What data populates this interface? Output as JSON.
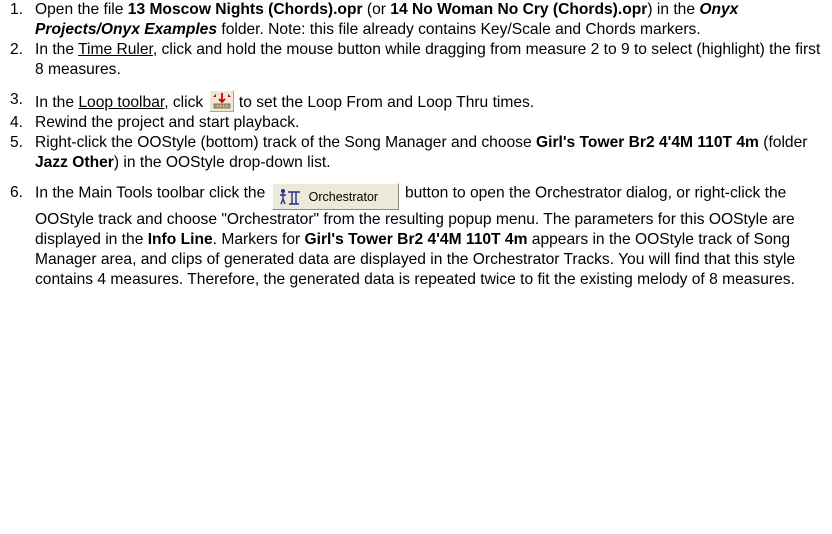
{
  "steps": [
    {
      "num": "1.",
      "a": "Open the file ",
      "b_file1": "13 Moscow Nights (Chords).opr",
      "c": " (or ",
      "d_file2": "14 No Woman No Cry (Chords).opr",
      "e": ") in the ",
      "f_folder": "Onyx Projects/Onyx Examples",
      "g": " folder. Note: this file already contains Key/Scale and Chords markers."
    },
    {
      "num": "2.",
      "a": "In the ",
      "b_link": "Time Ruler",
      "c": ", click and hold the mouse button while dragging from measure 2 to 9 to select (highlight) the first 8 measures."
    },
    {
      "num": "3.",
      "a": "In the ",
      "b_link": "Loop toolbar",
      "c": ", click ",
      "icon": "loop-set-icon",
      "d": " to set the Loop From and Loop Thru times."
    },
    {
      "num": "4.",
      "a": "Rewind the project and start playback."
    },
    {
      "num": "5.",
      "a": "Right-click the OOStyle (bottom) track of the Song Manager and choose ",
      "b_style": "Girl's Tower Br2 4'4M 110T 4m",
      "c": " (folder ",
      "d_folder": "Jazz Other",
      "e": ") in the OOStyle drop-down list."
    },
    {
      "num": "6.",
      "a": "In the Main Tools toolbar click the ",
      "button_label": "Orchestrator",
      "icon": "orchestrator-icon",
      "b": " button to open the Orchestrator dialog, or right-click the OOStyle track and choose \"Orchestrator\" from the resulting popup menu. The parameters for this OOStyle are displayed in the ",
      "c_info": "Info Line",
      "d": ". Markers for ",
      "e_style": "Girl's Tower Br2 4'4M 110T 4m",
      "f": " appears in the OOStyle track of Song Manager area, and clips of generated data are displayed in the Orchestrator Tracks. You will find that this style contains 4 measures. Therefore, the generated data is repeated twice to fit the existing melody of 8 measures."
    }
  ]
}
